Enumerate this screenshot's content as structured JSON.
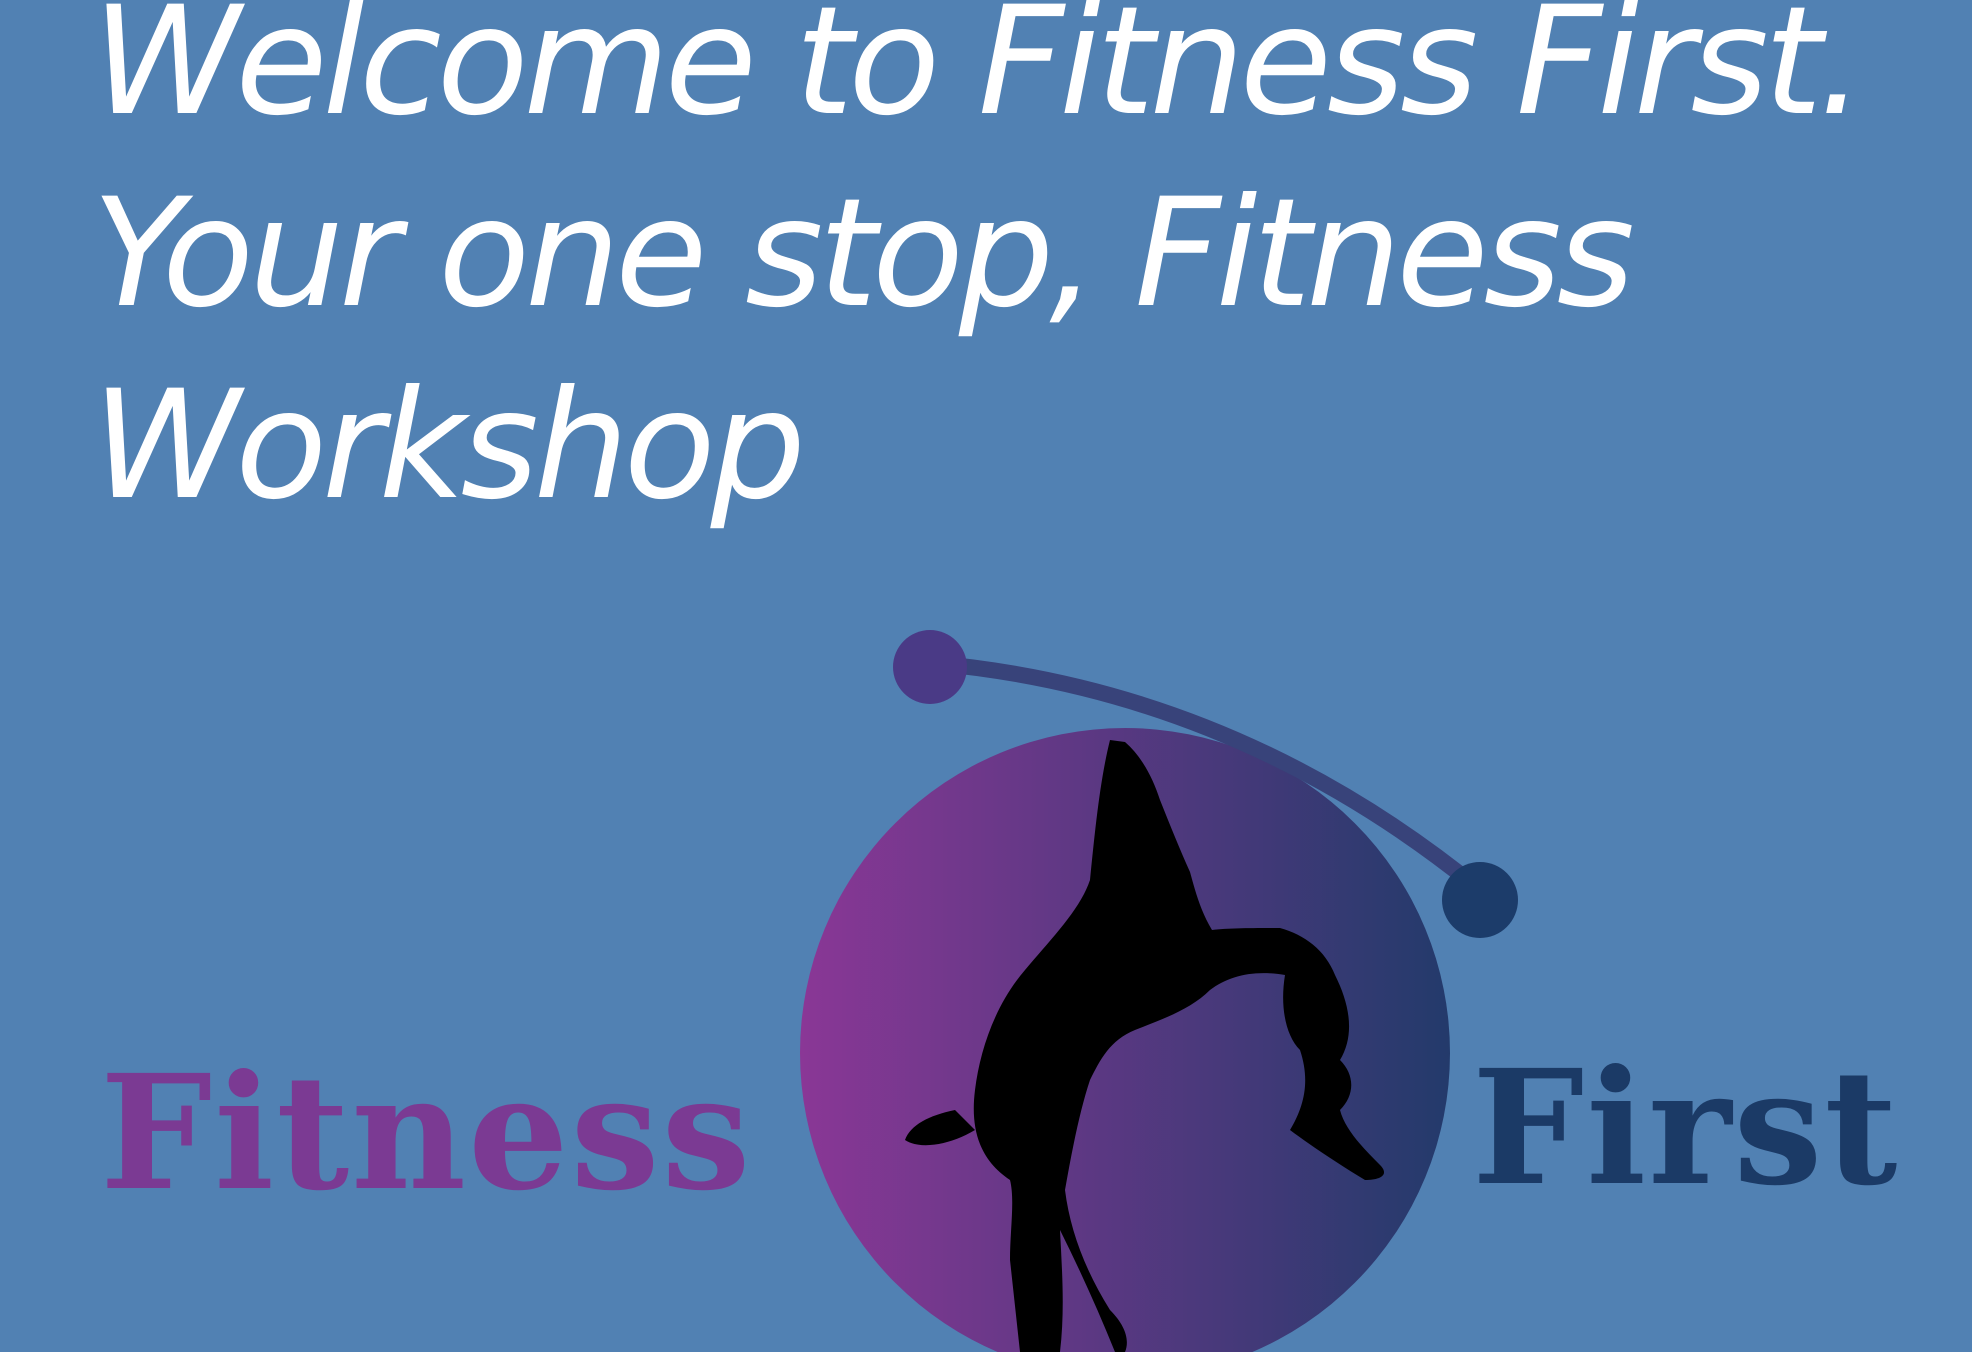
{
  "hero": {
    "line1": "Welcome to Fitness First.",
    "line2": "Your one stop, Fitness",
    "line3": "Workshop"
  },
  "logo": {
    "word_left": "Fitness",
    "word_right": "First",
    "icon": "gymnast-silhouette-icon"
  },
  "colors": {
    "background": "#5181b3",
    "text": "#ffffff",
    "word_left": "#7b3a93",
    "word_right": "#1b3a66",
    "circle_start": "#8a3796",
    "circle_end": "#233a6b",
    "orbit": "#38437a"
  }
}
